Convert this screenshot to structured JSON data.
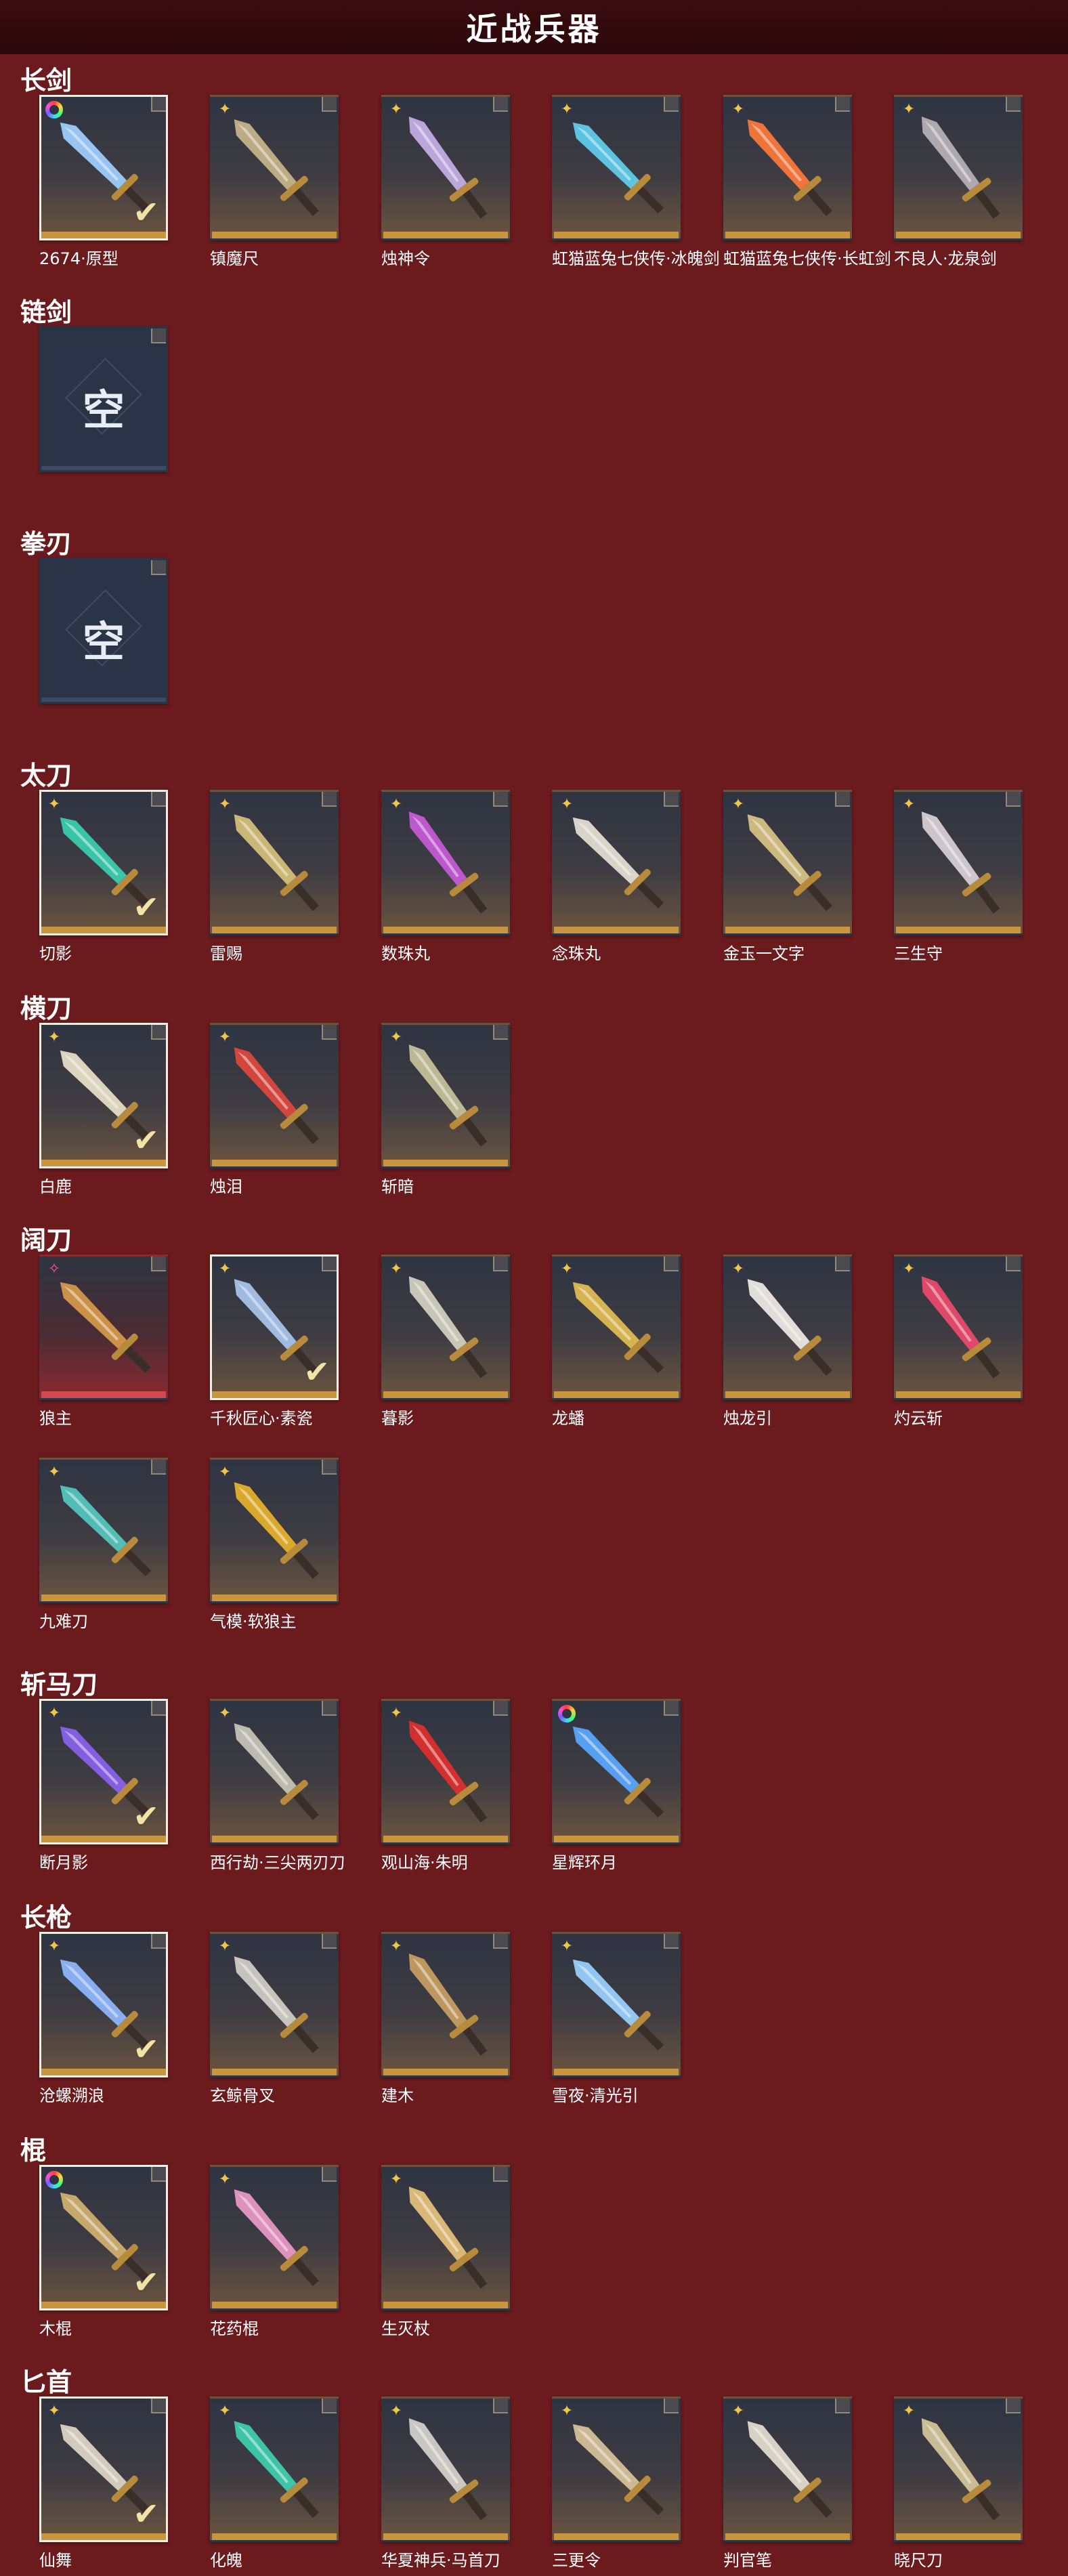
{
  "header": {
    "title": "近战兵器"
  },
  "empty_char": "空",
  "accent": {
    "background": "#6b1a1e",
    "header": "#2b080b",
    "gold_strip": "#c9963f",
    "red_strip": "#d24a50",
    "selected_border": "#f4efe2"
  },
  "sections": [
    {
      "title": "长剑",
      "items": [
        {
          "name": "2674·原型",
          "badge": "rainbow",
          "selected": true,
          "color": "#9fd0ff"
        },
        {
          "name": "镇魔尺",
          "badge": "star",
          "selected": false,
          "color": "#c9b58a"
        },
        {
          "name": "烛神令",
          "badge": "star",
          "selected": false,
          "color": "#c7b0e8"
        },
        {
          "name": "虹猫蓝兔七侠传·冰魄剑",
          "badge": "star",
          "selected": false,
          "color": "#5fd0ee"
        },
        {
          "name": "虹猫蓝兔七侠传·长虹剑",
          "badge": "star",
          "selected": false,
          "color": "#ff7a3a"
        },
        {
          "name": "不良人·龙泉剑",
          "badge": "star",
          "selected": false,
          "color": "#b9b2b8"
        }
      ]
    },
    {
      "title": "链剑",
      "items": [
        {
          "name": "",
          "badge": "none",
          "selected": false,
          "empty": true
        }
      ]
    },
    {
      "title": "拳刃",
      "items": [
        {
          "name": "",
          "badge": "none",
          "selected": false,
          "empty": true
        }
      ]
    },
    {
      "title": "太刀",
      "items": [
        {
          "name": "切影",
          "badge": "star",
          "selected": true,
          "color": "#3ad0b0"
        },
        {
          "name": "雷赐",
          "badge": "star",
          "selected": false,
          "color": "#d7c27a"
        },
        {
          "name": "数珠丸",
          "badge": "star",
          "selected": false,
          "color": "#c85ad8"
        },
        {
          "name": "念珠丸",
          "badge": "star",
          "selected": false,
          "color": "#e6e2d6"
        },
        {
          "name": "金玉一文字",
          "badge": "star",
          "selected": false,
          "color": "#d9c486"
        },
        {
          "name": "三生守",
          "badge": "star",
          "selected": false,
          "color": "#d9d2d8"
        }
      ]
    },
    {
      "title": "横刀",
      "items": [
        {
          "name": "白鹿",
          "badge": "star",
          "selected": true,
          "color": "#ece2c8"
        },
        {
          "name": "烛泪",
          "badge": "star",
          "selected": false,
          "color": "#e0483e"
        },
        {
          "name": "斩暗",
          "badge": "star",
          "selected": false,
          "color": "#c8c39b"
        }
      ]
    },
    {
      "title": "阔刀",
      "items": [
        {
          "name": "狼主",
          "badge": "pink",
          "selected": false,
          "red": true,
          "color": "#d89a4a"
        },
        {
          "name": "千秋匠心·素瓷",
          "badge": "star",
          "selected": true,
          "color": "#a9c6ee"
        },
        {
          "name": "暮影",
          "badge": "star",
          "selected": false,
          "color": "#d5d2c0"
        },
        {
          "name": "龙蟠",
          "badge": "star",
          "selected": false,
          "color": "#e3be52"
        },
        {
          "name": "烛龙引",
          "badge": "star",
          "selected": false,
          "color": "#f0ece6"
        },
        {
          "name": "灼云斩",
          "badge": "star",
          "selected": false,
          "color": "#ee4a6a"
        },
        {
          "name": "九难刀",
          "badge": "star",
          "selected": false,
          "color": "#55c9c0"
        },
        {
          "name": "气模·软狼主",
          "badge": "star",
          "selected": false,
          "color": "#e8b32a"
        }
      ]
    },
    {
      "title": "斩马刀",
      "items": [
        {
          "name": "断月影",
          "badge": "star",
          "selected": true,
          "color": "#8a62ee"
        },
        {
          "name": "西行劫·三尖两刃刀",
          "badge": "star",
          "selected": false,
          "color": "#c9c5b8"
        },
        {
          "name": "观山海·朱明",
          "badge": "star",
          "selected": false,
          "color": "#e0302e"
        },
        {
          "name": "星辉环月",
          "badge": "rainbow",
          "selected": false,
          "color": "#5aa8ff"
        }
      ]
    },
    {
      "title": "长枪",
      "items": [
        {
          "name": "沧螺溯浪",
          "badge": "star",
          "selected": true,
          "color": "#8fb8ff"
        },
        {
          "name": "玄鲸骨叉",
          "badge": "star",
          "selected": false,
          "color": "#d2cfc8"
        },
        {
          "name": "建木",
          "badge": "star",
          "selected": false,
          "color": "#caa062"
        },
        {
          "name": "雪夜·清光引",
          "badge": "star",
          "selected": false,
          "color": "#9ad2ff"
        }
      ]
    },
    {
      "title": "棍",
      "items": [
        {
          "name": "木棍",
          "badge": "rainbow",
          "selected": true,
          "color": "#d4b270"
        },
        {
          "name": "花药棍",
          "badge": "star",
          "selected": false,
          "color": "#ea9ac8"
        },
        {
          "name": "生灭杖",
          "badge": "star",
          "selected": false,
          "color": "#e7c27a"
        }
      ]
    },
    {
      "title": "匕首",
      "items": [
        {
          "name": "仙舞",
          "badge": "star",
          "selected": true,
          "color": "#e0d7c4"
        },
        {
          "name": "化魄",
          "badge": "star",
          "selected": false,
          "color": "#3ed0b0"
        },
        {
          "name": "华夏神兵·马首刀",
          "badge": "star",
          "selected": false,
          "color": "#d6d4cc"
        },
        {
          "name": "三更令",
          "badge": "star",
          "selected": false,
          "color": "#d9c49a"
        },
        {
          "name": "判官笔",
          "badge": "star",
          "selected": false,
          "color": "#e6e0d0"
        },
        {
          "name": "晓尺刀",
          "badge": "star",
          "selected": false,
          "color": "#d6c79a"
        }
      ]
    }
  ]
}
